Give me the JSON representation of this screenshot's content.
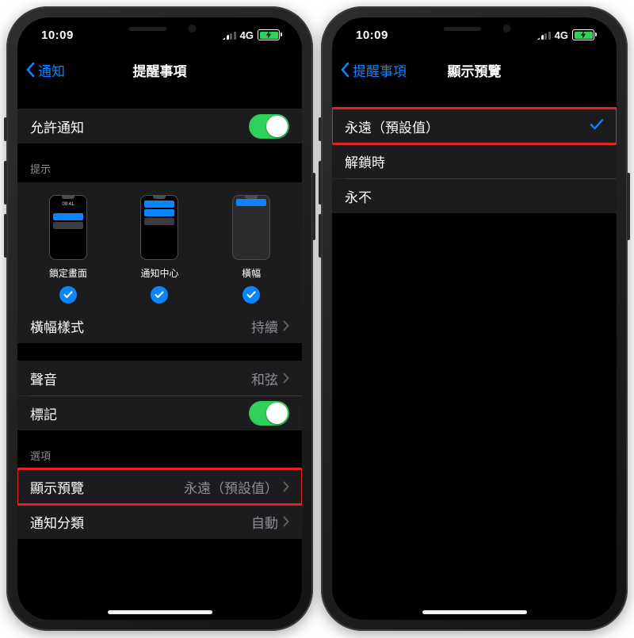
{
  "status": {
    "time": "10:09",
    "network": "4G"
  },
  "left": {
    "back": "通知",
    "title": "提醒事項",
    "allow_notifications": "允許通知",
    "section_alerts": "提示",
    "alert_lock": "鎖定畫面",
    "alert_nc": "通知中心",
    "alert_banner": "橫幅",
    "mini_time": "09:41",
    "banner_style_label": "橫幅樣式",
    "banner_style_value": "持續",
    "sound_label": "聲音",
    "sound_value": "和弦",
    "badge_label": "標記",
    "section_options": "選項",
    "show_preview_label": "顯示預覽",
    "show_preview_value": "永遠（預設值）",
    "grouping_label": "通知分類",
    "grouping_value": "自動"
  },
  "right": {
    "back": "提醒事項",
    "title": "顯示預覽",
    "opt_always": "永遠（預設值）",
    "opt_unlocked": "解鎖時",
    "opt_never": "永不"
  }
}
